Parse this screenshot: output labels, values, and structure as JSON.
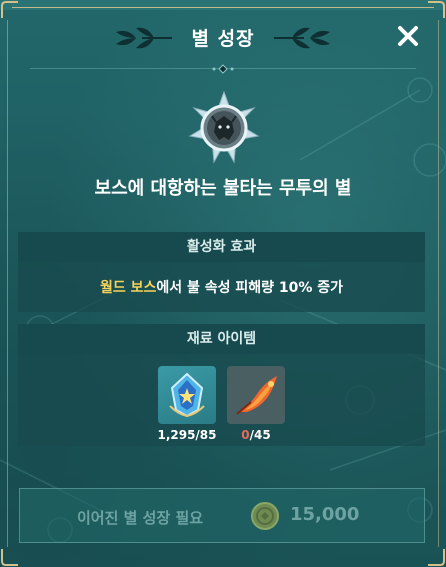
{
  "header": {
    "title": "별 성장",
    "close_icon": "close-icon"
  },
  "star": {
    "emblem_icon": "dragon-star-emblem-icon",
    "name": "보스에 대항하는 불타는 무투의 별"
  },
  "activation_effect": {
    "heading": "활성화 효과",
    "highlight": "월드 보스",
    "text": "에서 불 속성 피해량 10% 증가"
  },
  "materials": {
    "heading": "재료 아이템",
    "items": [
      {
        "icon": "blue-crystal-item-icon",
        "count": "1,295/85"
      },
      {
        "icon": "fire-feather-item-icon",
        "have": "0",
        "need": "/45"
      }
    ]
  },
  "action": {
    "label": "이어진 별 성장 필요",
    "currency_icon": "gold-coin-icon",
    "cost": "15,000"
  },
  "colors": {
    "panel_bg": "#1e5a5c",
    "section_head_bg": "#174a4f",
    "highlight": "#f3d35c",
    "insufficient": "#e86b5a",
    "disabled_text": "#6fa3a3"
  }
}
